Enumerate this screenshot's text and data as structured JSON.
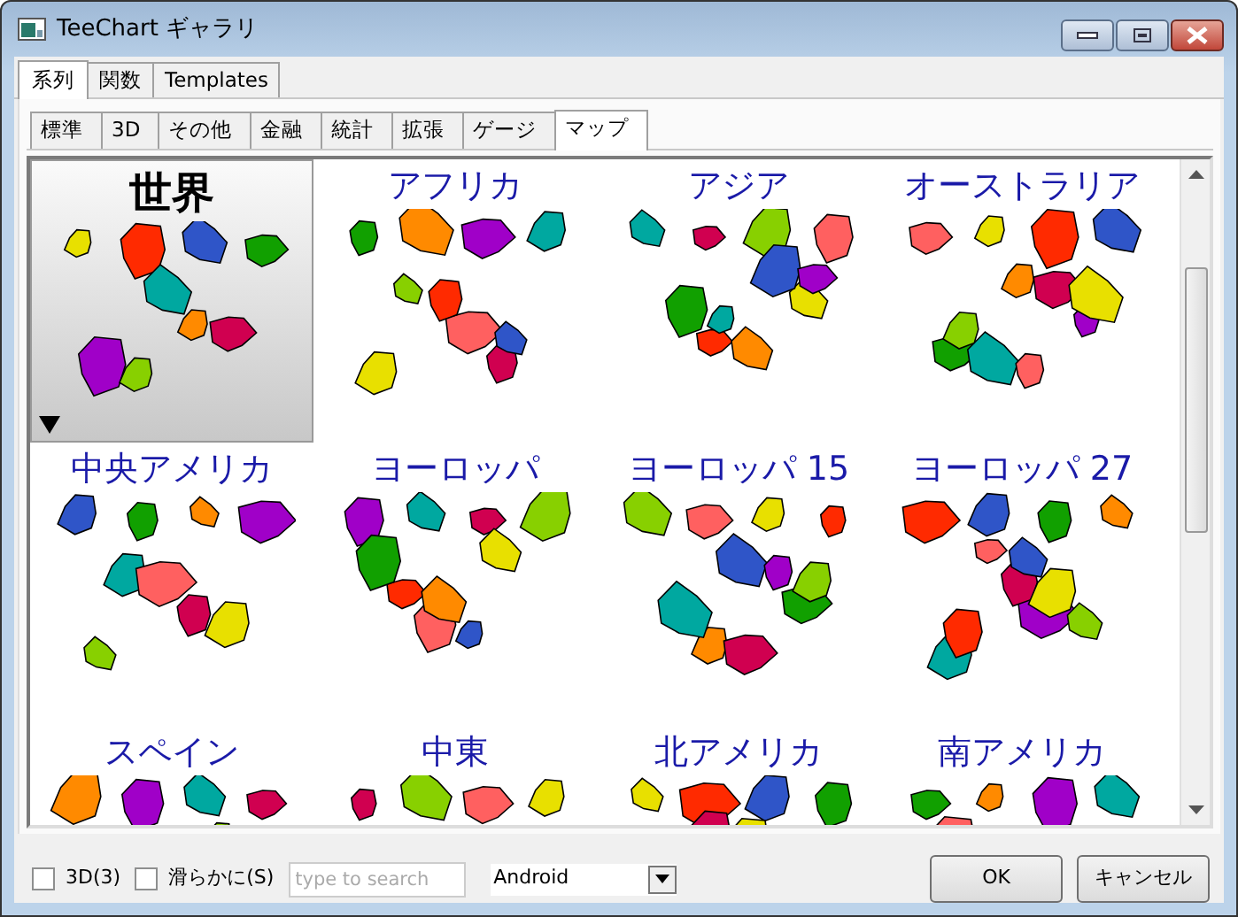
{
  "window": {
    "title": "TeeChart ギャラリ"
  },
  "tabs": [
    {
      "label": "系列",
      "selected": true
    },
    {
      "label": "関数",
      "selected": false
    },
    {
      "label": "Templates",
      "selected": false
    }
  ],
  "subtabs": [
    {
      "label": "標準",
      "selected": false
    },
    {
      "label": "3D",
      "selected": false
    },
    {
      "label": "その他",
      "selected": false
    },
    {
      "label": "金融",
      "selected": false
    },
    {
      "label": "統計",
      "selected": false
    },
    {
      "label": "拡張",
      "selected": false
    },
    {
      "label": "ゲージ",
      "selected": false
    },
    {
      "label": "マップ",
      "selected": true
    }
  ],
  "gallery": {
    "items": [
      {
        "label": "世界",
        "selected": true
      },
      {
        "label": "アフリカ",
        "selected": false
      },
      {
        "label": "アジア",
        "selected": false
      },
      {
        "label": "オーストラリア",
        "selected": false
      },
      {
        "label": "中央アメリカ",
        "selected": false
      },
      {
        "label": "ヨーロッパ",
        "selected": false
      },
      {
        "label": "ヨーロッパ 15",
        "selected": false
      },
      {
        "label": "ヨーロッパ 27",
        "selected": false
      },
      {
        "label": "スペイン",
        "selected": false
      },
      {
        "label": "中東",
        "selected": false
      },
      {
        "label": "北アメリカ",
        "selected": false
      },
      {
        "label": "南アメリカ",
        "selected": false
      }
    ]
  },
  "options": {
    "checkboxes": [
      {
        "label": "3D(3)",
        "checked": false
      },
      {
        "label": "滑らかに(S)",
        "checked": false
      }
    ],
    "search": {
      "placeholder": "type to search"
    },
    "style_select": {
      "value": "Android"
    }
  },
  "buttons": [
    {
      "label": "OK"
    },
    {
      "label": "キャンセル"
    }
  ]
}
